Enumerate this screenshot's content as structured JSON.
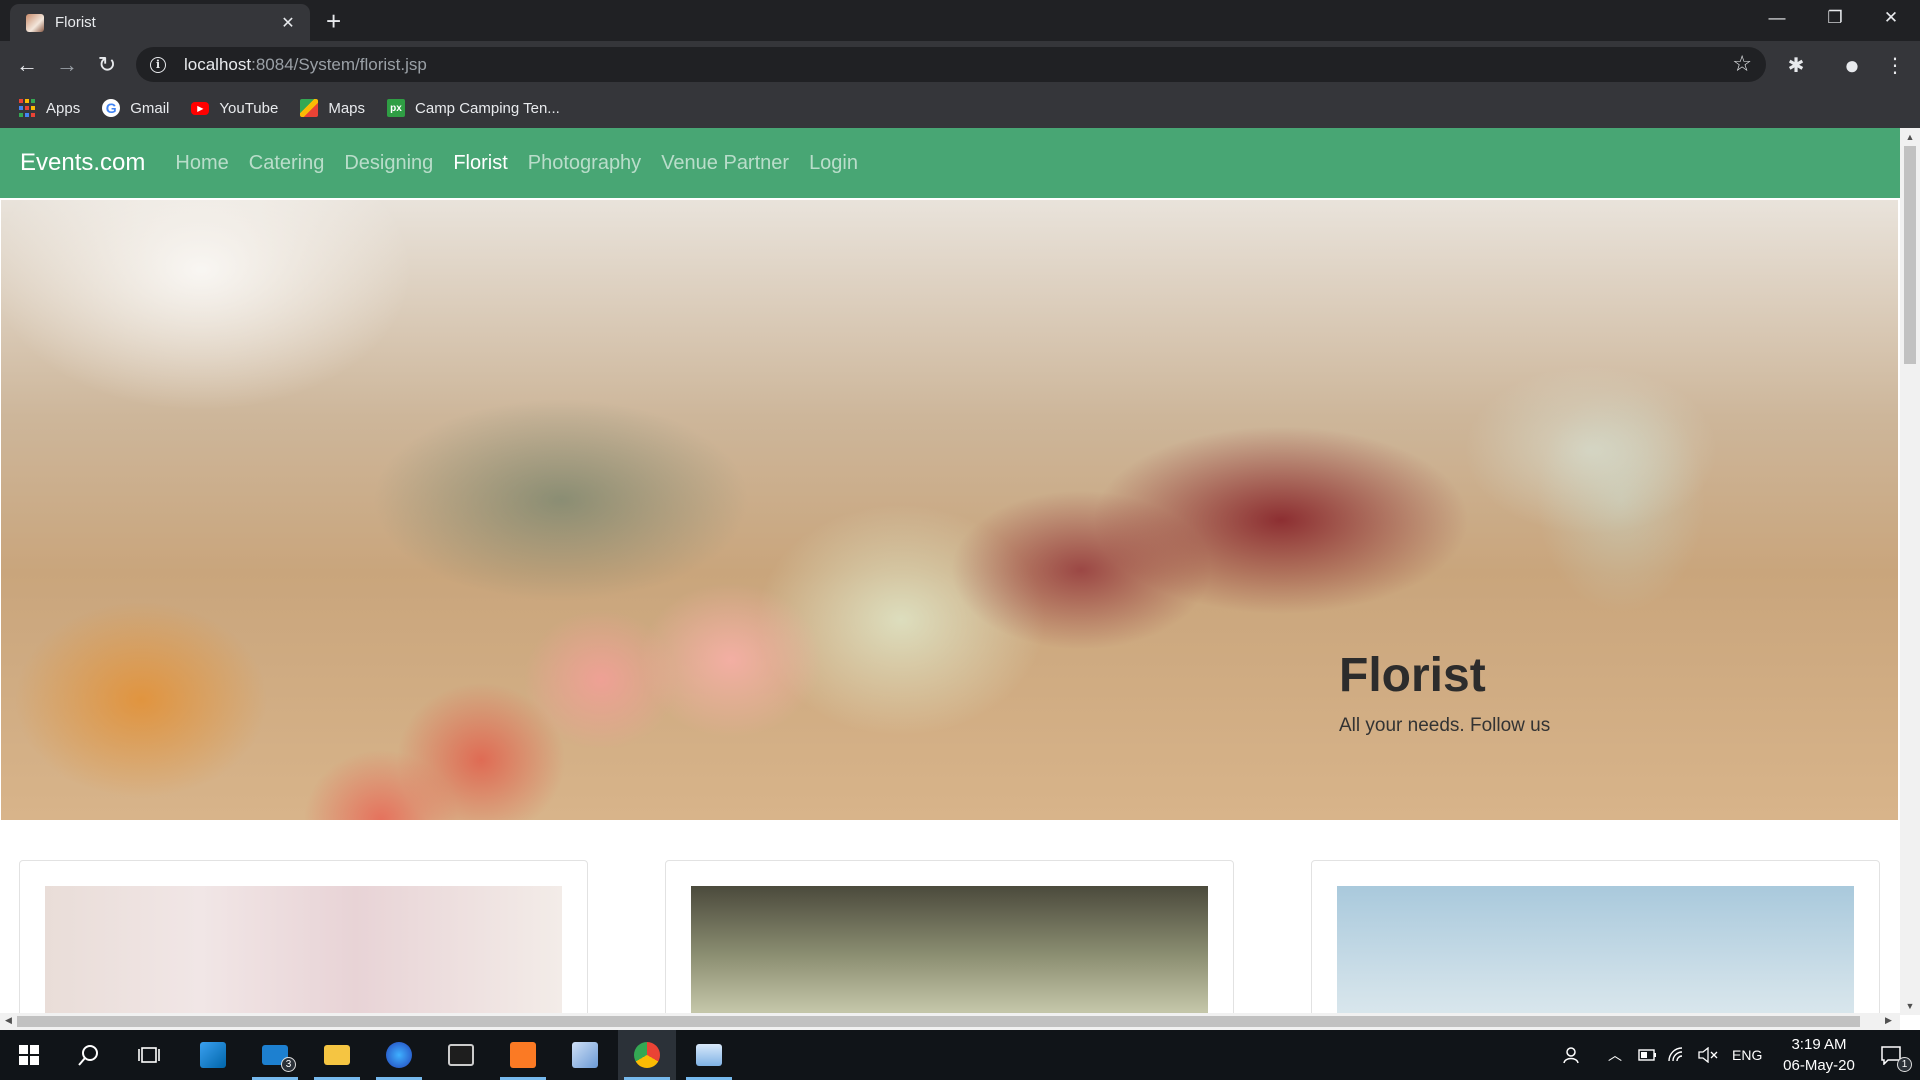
{
  "browser": {
    "tab": {
      "title": "Florist",
      "close": "✕"
    },
    "new_tab": "+",
    "window_controls": {
      "minimize": "—",
      "restore": "❐",
      "close": "✕"
    },
    "nav": {
      "back": "←",
      "forward": "→",
      "reload": "↻"
    },
    "address": {
      "host": "localhost",
      "path": ":8084/System/florist.jsp"
    },
    "icons": {
      "star": "☆",
      "extension": "✱",
      "profile": "●",
      "menu": "⋮"
    },
    "bookmarks": [
      {
        "label": "Apps",
        "icon": "apps-grid-icon"
      },
      {
        "label": "Gmail",
        "icon": "google-icon"
      },
      {
        "label": "YouTube",
        "icon": "youtube-icon"
      },
      {
        "label": "Maps",
        "icon": "maps-icon"
      },
      {
        "label": "Camp Camping Ten...",
        "icon": "px-icon"
      }
    ]
  },
  "site": {
    "brand": "Events.com",
    "nav": [
      "Home",
      "Catering",
      "Designing",
      "Florist",
      "Photography",
      "Venue Partner",
      "Login"
    ],
    "active_nav": "Florist",
    "accent_color": "#48a674",
    "hero": {
      "title": "Florist",
      "subtitle": "All your needs. Follow us"
    },
    "cards": [
      "florist-card-bouquets",
      "florist-card-flower-wall",
      "florist-card-sky"
    ]
  },
  "taskbar": {
    "apps": [
      "start",
      "search",
      "task-view",
      "vscode",
      "mail",
      "file-explorer",
      "firefox-dev",
      "terminal",
      "xampp",
      "virtualbox",
      "chrome",
      "photos"
    ],
    "mail_badge": "3",
    "tray": {
      "language": "ENG",
      "time": "3:19 AM",
      "date": "06-May-20",
      "notifications": "1"
    }
  }
}
